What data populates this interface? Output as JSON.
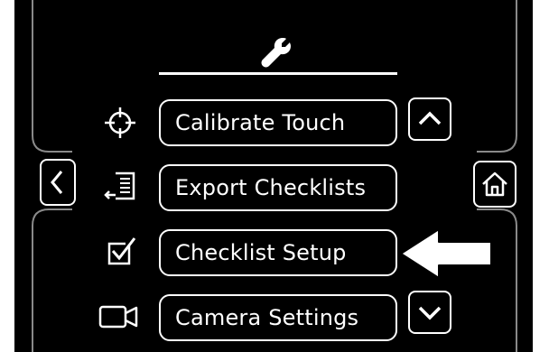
{
  "header": {
    "icon": "wrench-icon"
  },
  "menu": {
    "items": [
      {
        "label": "Calibrate Touch",
        "icon": "crosshair-target-icon"
      },
      {
        "label": "Export Checklists",
        "icon": "export-list-icon"
      },
      {
        "label": "Checklist Setup",
        "icon": "checkbox-checked-icon"
      },
      {
        "label": "Camera Settings",
        "icon": "camera-icon"
      }
    ]
  },
  "nav": {
    "back_icon": "chevron-left-icon",
    "home_icon": "home-icon",
    "scroll_up_icon": "chevron-up-icon",
    "scroll_down_icon": "chevron-down-icon"
  },
  "annotation": {
    "arrow": "pointer-arrow-left",
    "points_to": "Checklist Setup"
  },
  "colors": {
    "background": "#000000",
    "foreground": "#ffffff",
    "frame_line": "#8a8a8a"
  }
}
